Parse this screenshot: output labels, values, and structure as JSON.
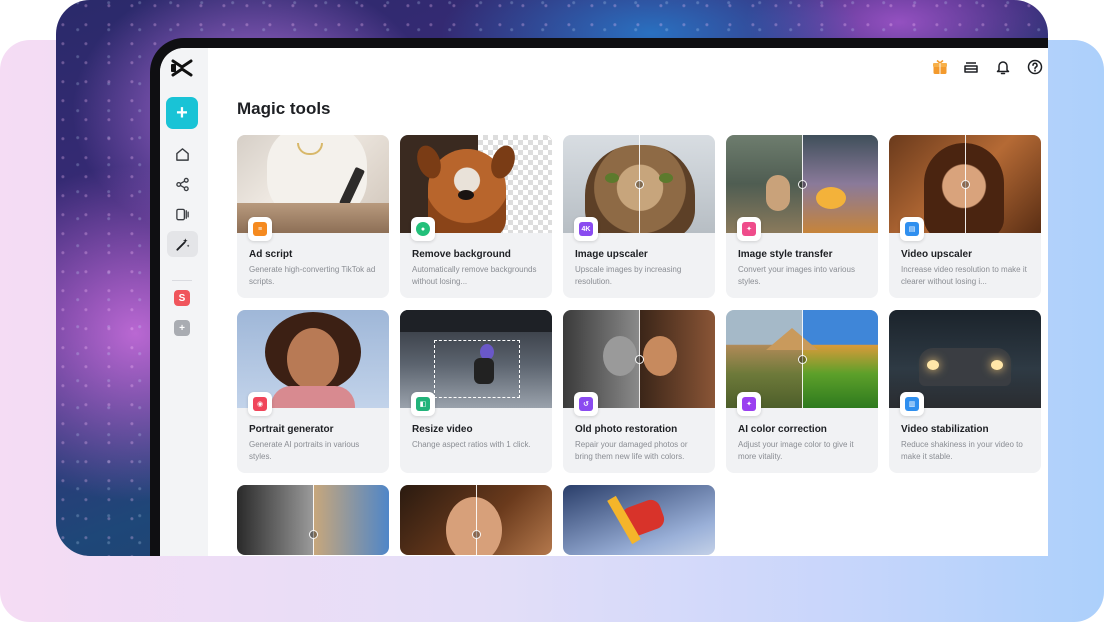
{
  "page": {
    "title": "Magic tools"
  },
  "sidebar": {
    "create_label": "+",
    "items": [
      {
        "name": "home",
        "icon": "home-icon"
      },
      {
        "name": "share",
        "icon": "share-icon"
      },
      {
        "name": "templates",
        "icon": "templates-icon"
      },
      {
        "name": "magic-tools",
        "icon": "magic-wand-icon",
        "active": true
      }
    ],
    "spaces": [
      {
        "label": "S",
        "color": "#f0555c"
      },
      {
        "label": "+",
        "color": "#a9acb2"
      }
    ]
  },
  "topbar": {
    "icons": [
      "gift-icon",
      "storage-icon",
      "bell-icon",
      "help-icon"
    ],
    "accent": "#f39a2d"
  },
  "tools": [
    {
      "title": "Ad script",
      "desc": "Generate high-converting TikTok ad scripts.",
      "icon": "ad-script-icon",
      "color": "#f58a1f",
      "glyph": "≡"
    },
    {
      "title": "Remove background",
      "desc": "Automatically remove backgrounds without losing...",
      "icon": "remove-background-icon",
      "color": "#22c07a",
      "glyph": "●"
    },
    {
      "title": "Image upscaler",
      "desc": "Upscale images by increasing resolution.",
      "icon": "image-upscaler-icon",
      "color": "#8a4bf0",
      "glyph": "4K"
    },
    {
      "title": "Image style transfer",
      "desc": "Convert your images into various styles.",
      "icon": "style-transfer-icon",
      "color": "#ef4c8b",
      "glyph": "✦"
    },
    {
      "title": "Video upscaler",
      "desc": "Increase video resolution to make it clearer without losing i...",
      "icon": "video-upscaler-icon",
      "color": "#2f8fef",
      "glyph": "▤"
    },
    {
      "title": "Portrait generator",
      "desc": "Generate AI portraits in various styles.",
      "icon": "portrait-generator-icon",
      "color": "#f0455a",
      "glyph": "◉"
    },
    {
      "title": "Resize video",
      "desc": "Change aspect ratios with 1 click.",
      "icon": "resize-video-icon",
      "color": "#22b37a",
      "glyph": "◧"
    },
    {
      "title": "Old photo restoration",
      "desc": "Repair your damaged photos or bring them new life with colors.",
      "icon": "photo-restoration-icon",
      "color": "#8a4bf0",
      "glyph": "↺"
    },
    {
      "title": "AI color correction",
      "desc": "Adjust your image color to give it more vitality.",
      "icon": "color-correction-icon",
      "color": "#9a3ff0",
      "glyph": "✦"
    },
    {
      "title": "Video stabilization",
      "desc": "Reduce shakiness in your video to make it stable.",
      "icon": "video-stabilization-icon",
      "color": "#2f8fef",
      "glyph": "▥"
    }
  ]
}
